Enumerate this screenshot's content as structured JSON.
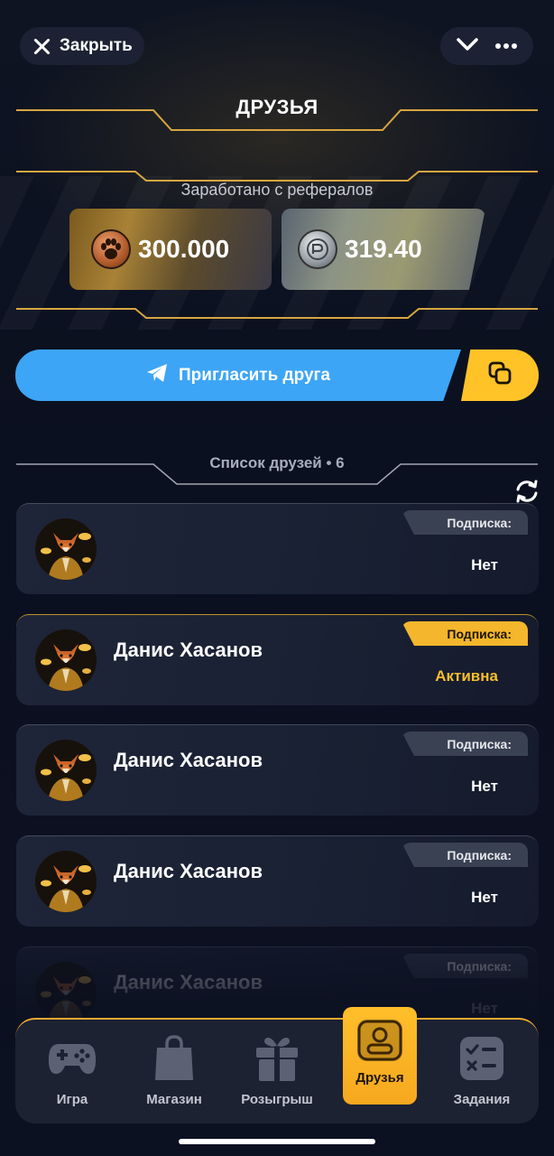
{
  "topbar": {
    "close_label": "Закрыть",
    "close_icon": "close-icon",
    "chevron_icon": "chevron-down-icon",
    "more_icon": "more-icon"
  },
  "page": {
    "title": "ДРУЗЬЯ",
    "earned_label": "Заработано с рефералов"
  },
  "balances": {
    "paw": {
      "value": "300.000",
      "icon": "paw-coin-icon"
    },
    "silver": {
      "value": "319.40",
      "icon": "silver-coin-icon"
    }
  },
  "invite": {
    "label": "Пригласить друга",
    "icon": "telegram-send-icon",
    "copy_icon": "copy-icon"
  },
  "friends": {
    "header": "Список друзей • 6",
    "refresh_icon": "refresh-icon",
    "items": [
      {
        "name": "",
        "tab_label": "Подписка:",
        "status": "Нет",
        "active": false
      },
      {
        "name": "Данис Хасанов",
        "tab_label": "Подписка:",
        "status": "Активна",
        "active": true
      },
      {
        "name": "Данис Хасанов",
        "tab_label": "Подписка:",
        "status": "Нет",
        "active": false
      },
      {
        "name": "Данис Хасанов",
        "tab_label": "Подписка:",
        "status": "Нет",
        "active": false
      },
      {
        "name": "Данис Хасанов",
        "tab_label": "Подписка:",
        "status": "Нет",
        "active": false
      }
    ]
  },
  "nav": {
    "items": [
      {
        "label": "Игра",
        "icon": "gamepad-icon"
      },
      {
        "label": "Магазин",
        "icon": "shopping-bag-icon"
      },
      {
        "label": "Розыгрыш",
        "icon": "gift-icon"
      },
      {
        "label": "Друзья",
        "icon": "user-icon",
        "active": true
      },
      {
        "label": "Задания",
        "icon": "tasks-icon"
      }
    ]
  },
  "colors": {
    "accent_gold": "#ffc328",
    "accent_blue": "#3da5f5",
    "background": "#0b1020"
  }
}
